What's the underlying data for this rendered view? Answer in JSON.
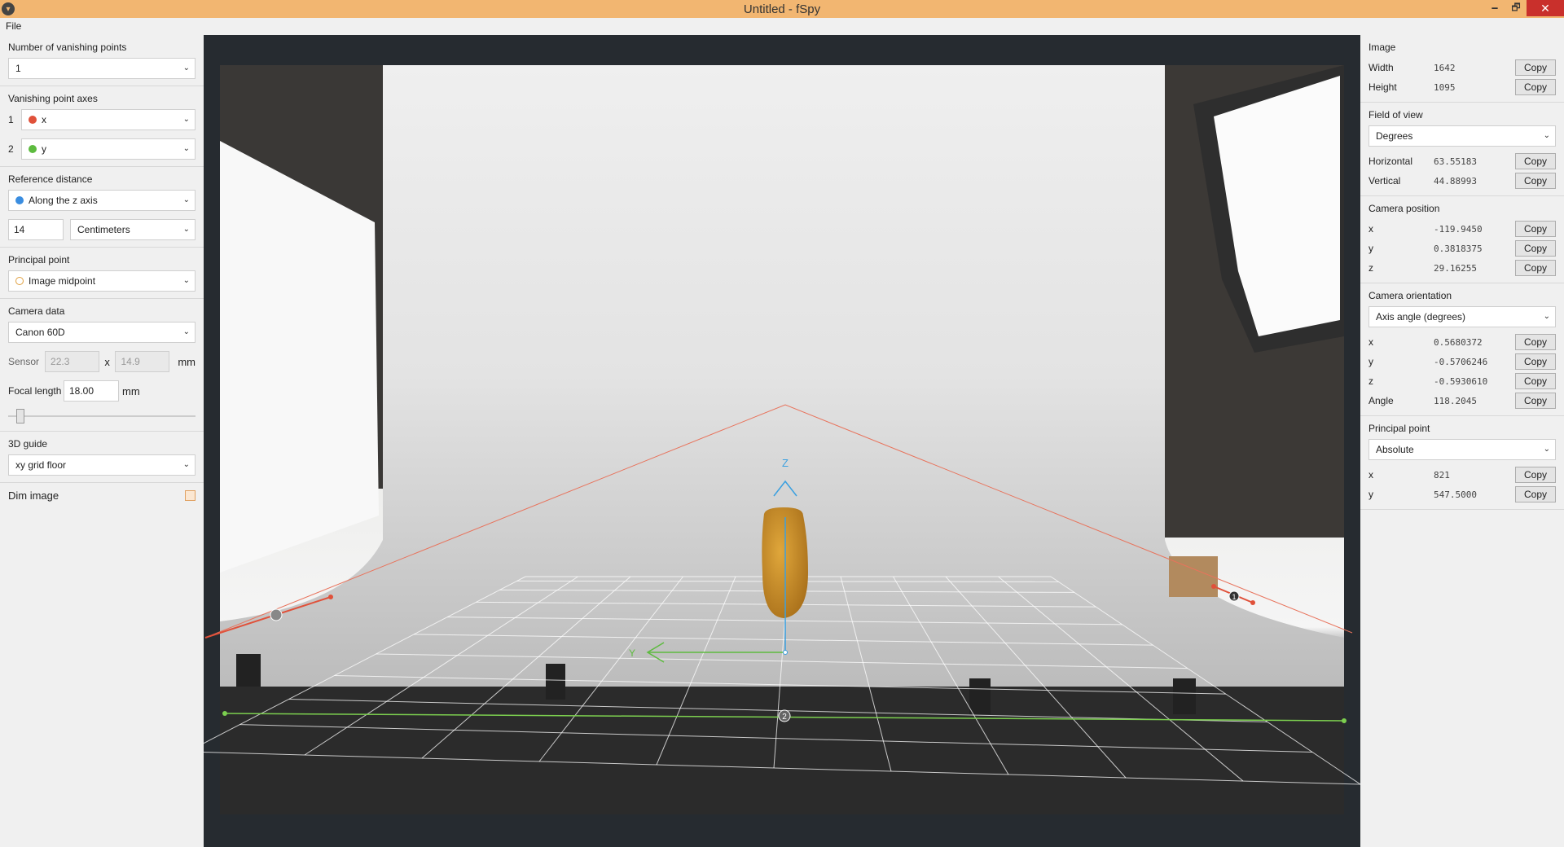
{
  "window": {
    "title": "Untitled - fSpy",
    "minimize": "🗕",
    "maximize": "🗗",
    "close": "✕"
  },
  "menu": {
    "file": "File"
  },
  "left": {
    "vp_count_label": "Number of vanishing points",
    "vp_count_value": "1",
    "vp_axes_label": "Vanishing point axes",
    "axes": [
      {
        "index": "1",
        "value": "x",
        "color": "#e0513a"
      },
      {
        "index": "2",
        "value": "y",
        "color": "#5dbb3f"
      }
    ],
    "ref_distance_label": "Reference distance",
    "ref_distance_axis": "Along the z axis",
    "ref_distance_color": "#3a8de0",
    "ref_distance_value": "14",
    "ref_distance_unit": "Centimeters",
    "principal_point_label": "Principal point",
    "principal_point_value": "Image midpoint",
    "camera_data_label": "Camera data",
    "camera_model": "Canon 60D",
    "sensor_label": "Sensor",
    "sensor_w": "22.3",
    "sensor_x": "x",
    "sensor_h": "14.9",
    "sensor_unit": "mm",
    "focal_label": "Focal length",
    "focal_value": "18.00",
    "focal_unit": "mm",
    "guide_label": "3D guide",
    "guide_value": "xy grid floor",
    "dim_label": "Dim image"
  },
  "canvas": {
    "axis_z": "Z",
    "axis_y": "Y",
    "marker_1": "1",
    "marker_2": "2"
  },
  "right": {
    "copy": "Copy",
    "image_label": "Image",
    "width_label": "Width",
    "width_value": "1642",
    "height_label": "Height",
    "height_value": "1095",
    "fov_label": "Field of view",
    "fov_unit": "Degrees",
    "h_label": "Horizontal",
    "h_value": "63.55183",
    "v_label": "Vertical",
    "v_value": "44.88993",
    "campos_label": "Camera position",
    "cp_x_label": "x",
    "cp_x": "-119.9450",
    "cp_y_label": "y",
    "cp_y": "0.3818375",
    "cp_z_label": "z",
    "cp_z": "29.16255",
    "orient_label": "Camera orientation",
    "orient_mode": "Axis angle (degrees)",
    "or_x_label": "x",
    "or_x": "0.5680372",
    "or_y_label": "y",
    "or_y": "-0.5706246",
    "or_z_label": "z",
    "or_z": "-0.5930610",
    "or_a_label": "Angle",
    "or_a": "118.2045",
    "pp_label": "Principal point",
    "pp_mode": "Absolute",
    "pp_x_label": "x",
    "pp_x": "821",
    "pp_y_label": "y",
    "pp_y": "547.5000"
  }
}
